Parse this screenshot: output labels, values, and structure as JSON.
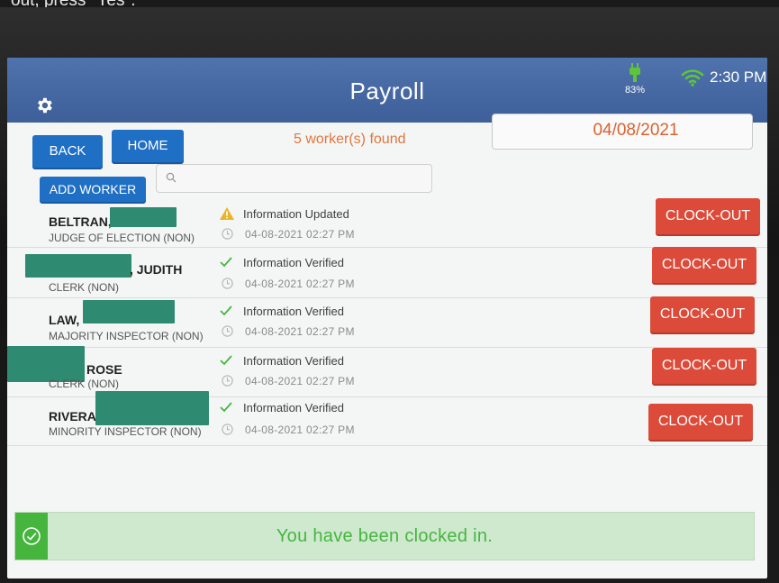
{
  "caption": "out, press \"Yes\".",
  "header": {
    "title": "Payroll",
    "battery_pct": "83%",
    "time": "2:30 PM"
  },
  "toolbar": {
    "back_label": "BACK",
    "home_label": "HOME",
    "add_worker_label": "ADD WORKER",
    "found_text": "5 worker(s) found",
    "date": "04/08/2021"
  },
  "search": {
    "value": "",
    "placeholder": ""
  },
  "workers": [
    {
      "name": "BELTRAN,",
      "role": "JUDGE OF ELECTION (NON)",
      "status": "Information Updated",
      "status_type": "warning",
      "timestamp": "04-08-2021 02:27 PM",
      "action": "CLOCK-OUT"
    },
    {
      "name": ", JUDITH",
      "role": "CLERK (NON)",
      "status": "Information Verified",
      "status_type": "verified",
      "timestamp": "04-08-2021 02:27 PM",
      "action": "CLOCK-OUT"
    },
    {
      "name": "LAW,",
      "role": "MAJORITY INSPECTOR (NON)",
      "status": "Information Verified",
      "status_type": "verified",
      "timestamp": "04-08-2021 02:27 PM",
      "action": "CLOCK-OUT"
    },
    {
      "name": "ROSE",
      "role": "CLERK (NON)",
      "status": "Information Verified",
      "status_type": "verified",
      "timestamp": "04-08-2021 02:27 PM",
      "action": "CLOCK-OUT"
    },
    {
      "name": "RIVERA",
      "role": "MINORITY INSPECTOR (NON)",
      "status": "Information Verified",
      "status_type": "verified",
      "timestamp": "04-08-2021 02:27 PM",
      "action": "CLOCK-OUT"
    }
  ],
  "toast": {
    "message": "You have been clocked in."
  },
  "colors": {
    "header_bg": "#4a6ea9",
    "primary_button": "#1f6fc5",
    "danger_button": "#dc4a39",
    "accent_orange": "#e2763a",
    "success_green": "#46b53e",
    "warning_yellow": "#e9b42a"
  },
  "icons": {
    "settings": "gear-icon",
    "battery": "battery-icon",
    "wifi": "wifi-icon",
    "search": "search-icon",
    "warning": "warning-icon",
    "verified": "checkmark-icon",
    "time": "clock-icon",
    "toast": "check-circle-icon"
  }
}
